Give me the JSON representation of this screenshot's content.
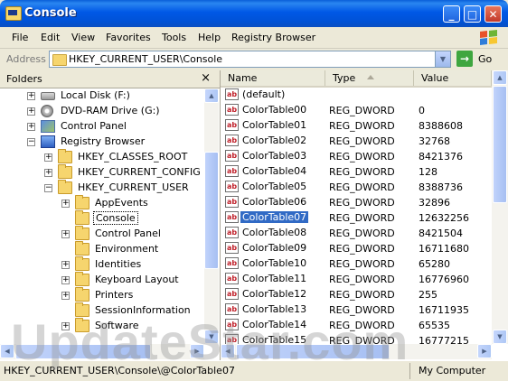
{
  "window": {
    "title": "Console"
  },
  "menu": [
    "File",
    "Edit",
    "View",
    "Favorites",
    "Tools",
    "Help",
    "Registry Browser"
  ],
  "address": {
    "label": "Address",
    "value": "HKEY_CURRENT_USER\\Console",
    "go": "Go"
  },
  "folders": {
    "title": "Folders",
    "close": "×",
    "tree": [
      {
        "label": "Local Disk (F:)",
        "icon": "disk-icon",
        "expander": "+"
      },
      {
        "label": "DVD-RAM Drive (G:)",
        "icon": "dvd-drive-icon",
        "expander": "+"
      },
      {
        "label": "Control Panel",
        "icon": "control-panel-icon",
        "expander": "+"
      },
      {
        "label": "Registry Browser",
        "icon": "registry-icon",
        "expander": "−"
      },
      {
        "label": "HKEY_CLASSES_ROOT",
        "icon": "folder-icon",
        "expander": "+"
      },
      {
        "label": "HKEY_CURRENT_CONFIG",
        "icon": "folder-icon",
        "expander": "+"
      },
      {
        "label": "HKEY_CURRENT_USER",
        "icon": "folder-icon",
        "expander": "−"
      },
      {
        "label": "AppEvents",
        "icon": "folder-icon",
        "expander": "+"
      },
      {
        "label": "Console",
        "icon": "folder-icon",
        "expander": "",
        "selected": true
      },
      {
        "label": "Control Panel",
        "icon": "folder-icon",
        "expander": "+"
      },
      {
        "label": "Environment",
        "icon": "folder-icon",
        "expander": ""
      },
      {
        "label": "Identities",
        "icon": "folder-icon",
        "expander": "+"
      },
      {
        "label": "Keyboard Layout",
        "icon": "folder-icon",
        "expander": "+"
      },
      {
        "label": "Printers",
        "icon": "folder-icon",
        "expander": "+"
      },
      {
        "label": "SessionInformation",
        "icon": "folder-icon",
        "expander": ""
      },
      {
        "label": "Software",
        "icon": "folder-icon",
        "expander": "+"
      }
    ]
  },
  "list": {
    "columns": [
      "Name",
      "Type",
      "Value"
    ],
    "rows": [
      {
        "name": "(default)",
        "type": "",
        "value": ""
      },
      {
        "name": "ColorTable00",
        "type": "REG_DWORD",
        "value": "0"
      },
      {
        "name": "ColorTable01",
        "type": "REG_DWORD",
        "value": "8388608"
      },
      {
        "name": "ColorTable02",
        "type": "REG_DWORD",
        "value": "32768"
      },
      {
        "name": "ColorTable03",
        "type": "REG_DWORD",
        "value": "8421376"
      },
      {
        "name": "ColorTable04",
        "type": "REG_DWORD",
        "value": "128"
      },
      {
        "name": "ColorTable05",
        "type": "REG_DWORD",
        "value": "8388736"
      },
      {
        "name": "ColorTable06",
        "type": "REG_DWORD",
        "value": "32896"
      },
      {
        "name": "ColorTable07",
        "type": "REG_DWORD",
        "value": "12632256",
        "selected": true
      },
      {
        "name": "ColorTable08",
        "type": "REG_DWORD",
        "value": "8421504"
      },
      {
        "name": "ColorTable09",
        "type": "REG_DWORD",
        "value": "16711680"
      },
      {
        "name": "ColorTable10",
        "type": "REG_DWORD",
        "value": "65280"
      },
      {
        "name": "ColorTable11",
        "type": "REG_DWORD",
        "value": "16776960"
      },
      {
        "name": "ColorTable12",
        "type": "REG_DWORD",
        "value": "255"
      },
      {
        "name": "ColorTable13",
        "type": "REG_DWORD",
        "value": "16711935"
      },
      {
        "name": "ColorTable14",
        "type": "REG_DWORD",
        "value": "65535"
      },
      {
        "name": "ColorTable15",
        "type": "REG_DWORD",
        "value": "16777215"
      }
    ]
  },
  "status": {
    "path": "HKEY_CURRENT_USER\\Console\\@ColorTable07",
    "zone": "My Computer"
  },
  "watermark": "UpdateStar.com",
  "colors": {
    "title_bar": "#0058E6",
    "selection": "#316AC5",
    "chrome": "#ECE9D8"
  }
}
